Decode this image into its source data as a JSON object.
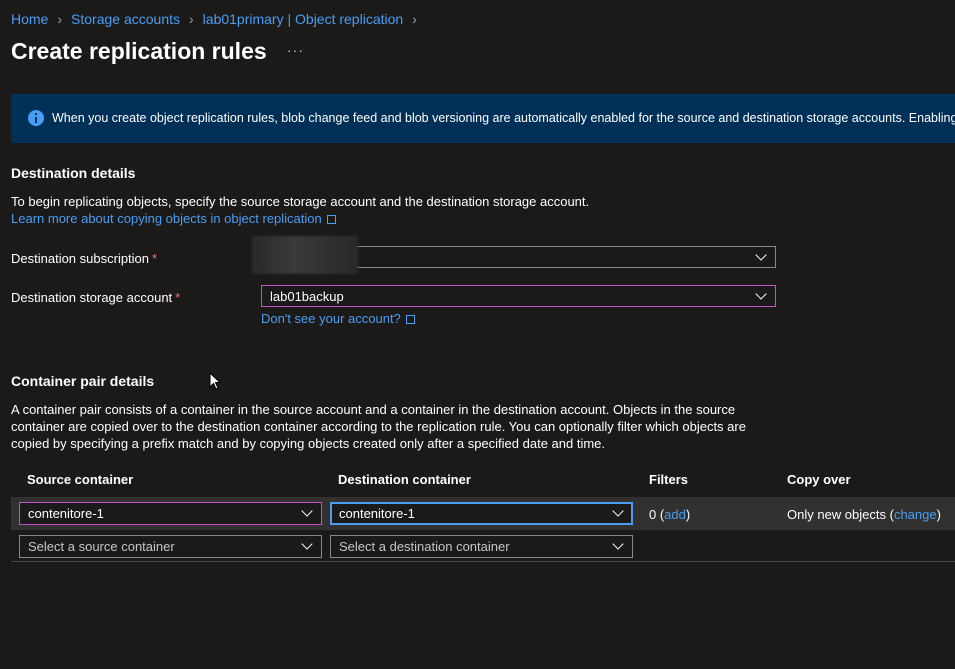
{
  "breadcrumb": {
    "items": [
      "Home",
      "Storage accounts",
      "lab01primary | Object replication"
    ]
  },
  "page": {
    "title": "Create replication rules",
    "more": "···"
  },
  "banner": {
    "text": "When you create object replication rules, blob change feed and blob versioning are automatically enabled for the source and destination storage accounts. Enabling these"
  },
  "destination": {
    "title": "Destination details",
    "description": "To begin replicating objects, specify the source storage account and the destination storage account.",
    "learn_more": "Learn more about copying objects in object replication",
    "subscription_label": "Destination subscription",
    "subscription_value": "",
    "storage_label": "Destination storage account",
    "storage_value": "lab01backup",
    "dont_see": "Don't see your account?",
    "required_mark": "*"
  },
  "container_pairs": {
    "title": "Container pair details",
    "description": "A container pair consists of a container in the source account and a container in the destination account. Objects in the source container are copied over to the destination container according to the replication rule. You can optionally filter which objects are copied by specifying a prefix match and by copying objects created only after a specified date and time.",
    "columns": [
      "Source container",
      "Destination container",
      "Filters",
      "Copy over"
    ],
    "rows": [
      {
        "source": "contenitore-1",
        "destination": "contenitore-1",
        "filters_count": "0 (",
        "filters_link": "add",
        "filters_close": ")",
        "copy_over": "Only new objects (",
        "copy_link": "change",
        "copy_close": ")"
      }
    ],
    "source_placeholder": "Select a source container",
    "destination_placeholder": "Select a destination container"
  },
  "colors": {
    "background": "#1b1a19",
    "link": "#479ef5",
    "banner": "#002f57",
    "required": "#f1707b",
    "focus_purple": "#c74ecf"
  }
}
